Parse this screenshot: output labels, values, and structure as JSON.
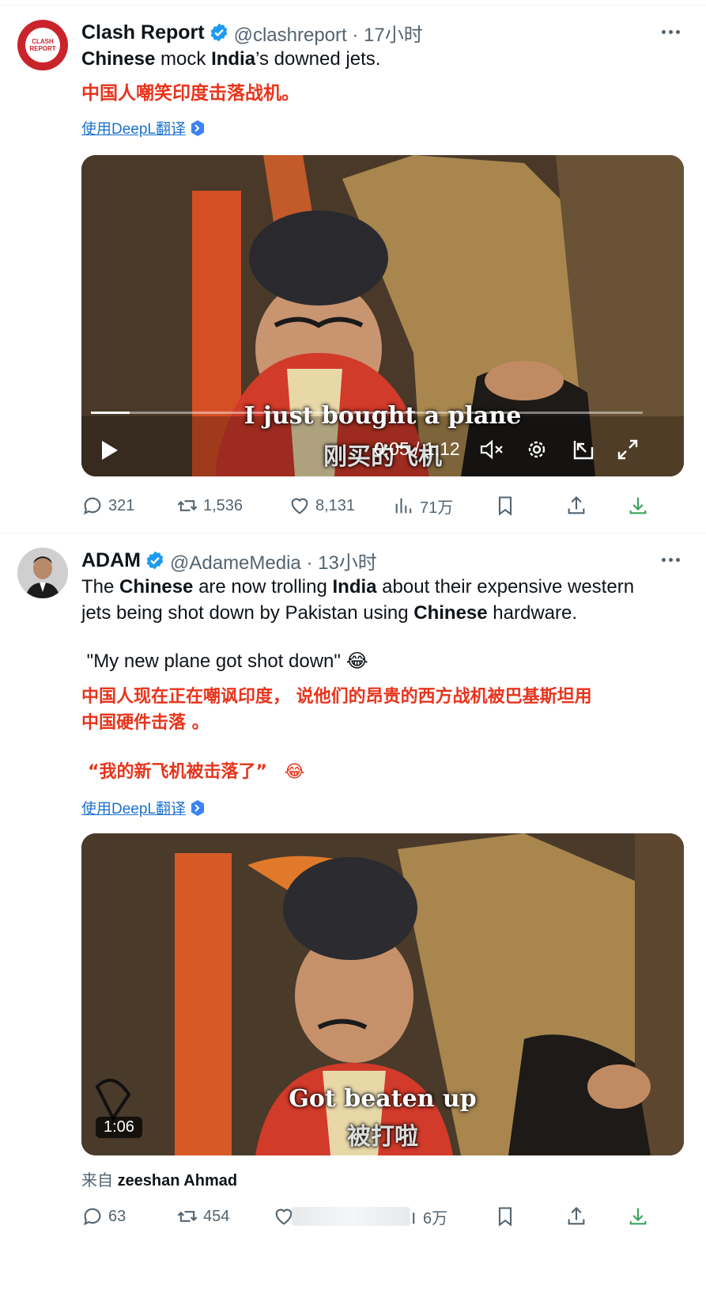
{
  "tweet1": {
    "name": "Clash Report",
    "handle_time": "@clashreport · 17小时",
    "text_parts": [
      "Chinese",
      " mock ",
      "India",
      "’s downed jets."
    ],
    "translation": "中国人嘲笑印度击落战机。",
    "translate_link": "使用DeepL翻译",
    "avatar_text": "CLASH REPORT",
    "video": {
      "subtitle_en": "I just bought a plane",
      "subtitle_zh": "刚买的飞机",
      "time": "0:05 / 1:12"
    },
    "stats": {
      "replies": "321",
      "reposts": "1,536",
      "likes": "8,131",
      "views": "71万"
    }
  },
  "tweet2": {
    "name": "ADAM",
    "handle_time": "@AdameMedia · 13小时",
    "text_line1_parts": [
      "The ",
      "Chinese",
      " are now trolling ",
      "India",
      " about their expensive western"
    ],
    "text_line2_parts": [
      "jets being shot down by Pakistan using ",
      "Chinese",
      " hardware."
    ],
    "quote": " \"My new plane got shot down\" ",
    "quote_emoji": "😂",
    "translation_line1": "中国人现在正在嘲讽印度， 说他们的昂贵的西方战机被巴基斯坦用",
    "translation_line2": "中国硬件击落 。",
    "translation_quote": "“我的新飞机被击落了”",
    "translation_emoji": "😂",
    "translate_link": "使用DeepL翻译",
    "video": {
      "subtitle_en": "Got beaten up",
      "subtitle_zh": "被打啦",
      "duration": "1:06"
    },
    "source_prefix": "来自",
    "source_name": "zeeshan Ahmad",
    "stats": {
      "replies": "63",
      "reposts": "454",
      "views": "6万"
    }
  },
  "colors": {
    "accent": "#1d9bf0",
    "red_text": "#e8341c",
    "secondary_text": "#536471",
    "link": "#1d72d0"
  }
}
